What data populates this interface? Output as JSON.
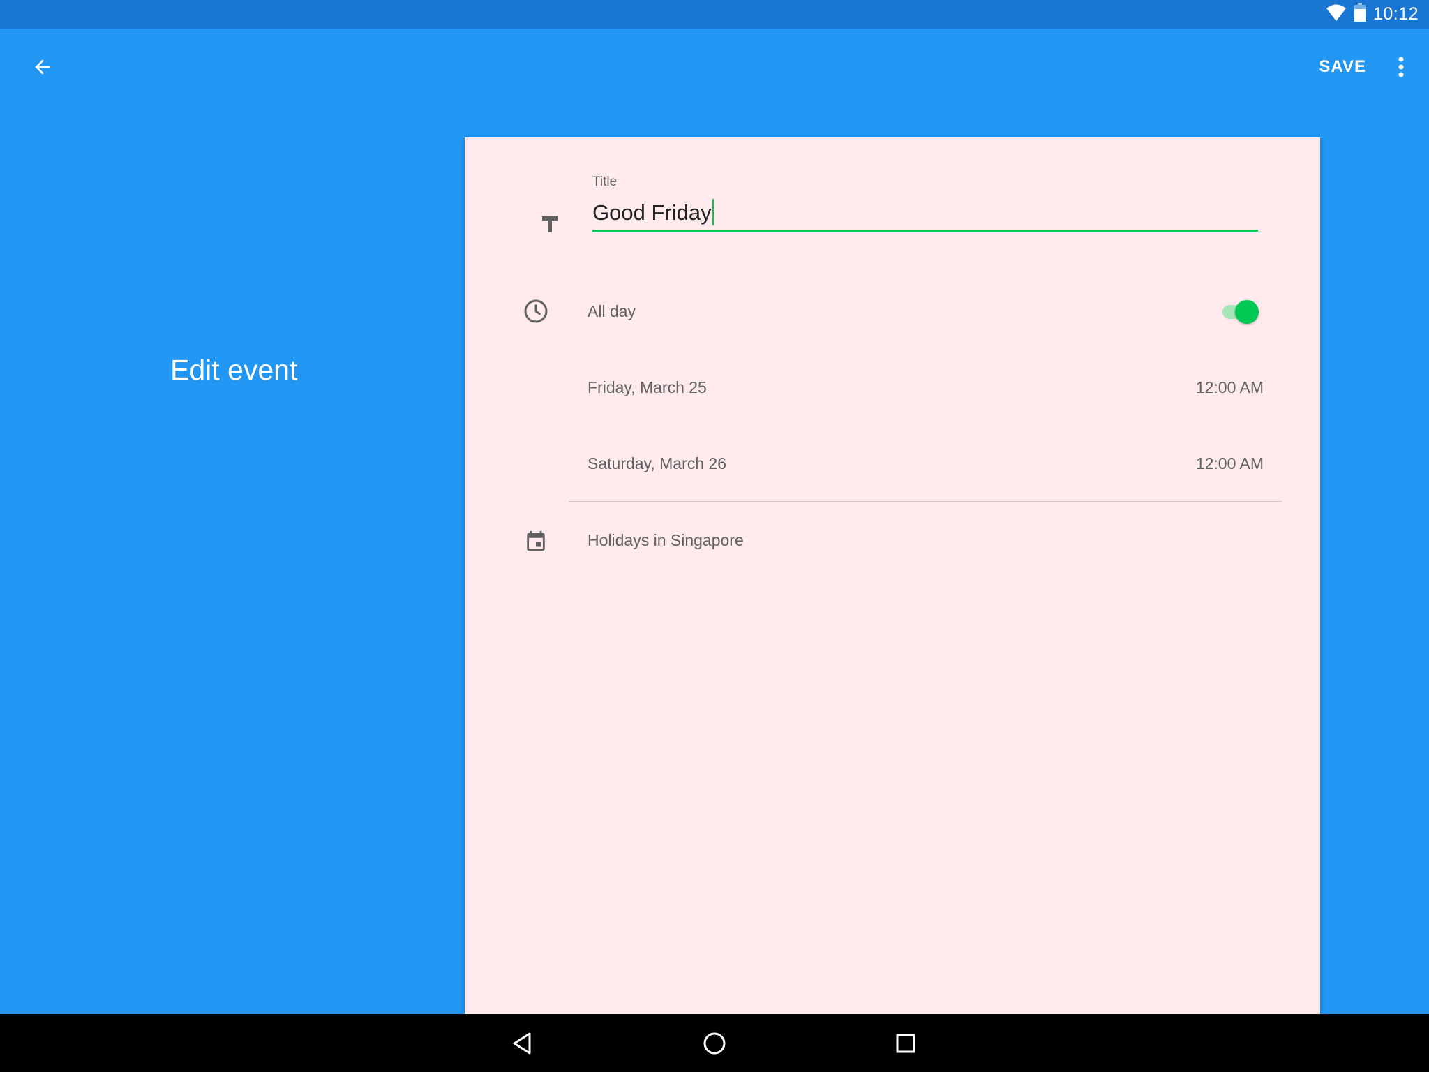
{
  "status_bar": {
    "time": "10:12",
    "icons": [
      "wifi-icon",
      "battery-icon"
    ]
  },
  "toolbar": {
    "back_icon": "arrow-back-icon",
    "save_label": "SAVE",
    "more_icon": "more-vert-icon"
  },
  "page": {
    "title": "Edit event"
  },
  "form": {
    "title_label": "Title",
    "title_value": "Good Friday",
    "title_icon": "text-format-icon",
    "all_day_label": "All day",
    "all_day_icon": "clock-icon",
    "all_day_on": true,
    "start_date": "Friday, March 25",
    "start_time": "12:00 AM",
    "end_date": "Saturday, March 26",
    "end_time": "12:00 AM",
    "calendar_icon": "calendar-icon",
    "calendar_name": "Holidays in Singapore"
  },
  "nav_bar": {
    "icons": [
      "nav-back-icon",
      "nav-home-icon",
      "nav-recents-icon"
    ]
  },
  "colors": {
    "app_bar": "#2196f3",
    "status_bar": "#1976d2",
    "card_background": "#ffebee",
    "accent": "#00c853",
    "secondary_text": "#616161"
  }
}
